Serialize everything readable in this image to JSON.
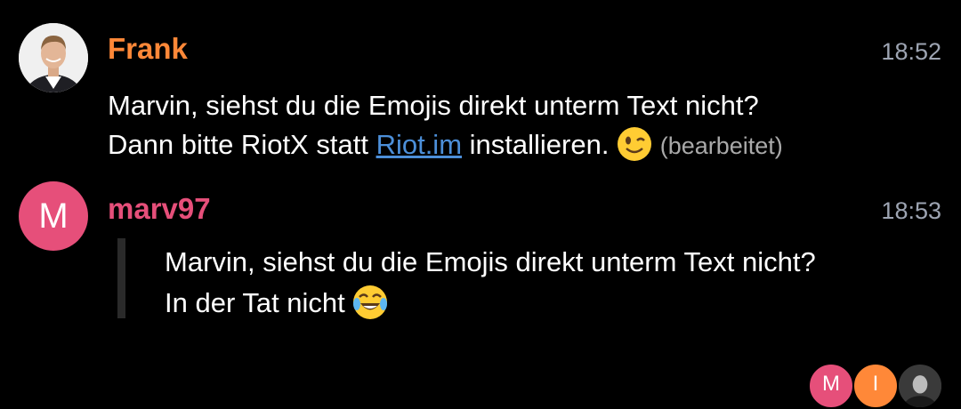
{
  "messages": [
    {
      "sender": "Frank",
      "sender_color": "#ff8838",
      "time": "18:52",
      "avatar": "frank-photo",
      "lines": {
        "line1": "Marvin, siehst du die Emojis direkt unterm Text nicht?",
        "line2_prefix": "Dann bitte RiotX statt",
        "link_text": "Riot.im",
        "line2_suffix": "installieren.",
        "emoji": "winking-face",
        "edited": "(bearbeitet)"
      }
    },
    {
      "sender": "marv97",
      "sender_color": "#e64f7a",
      "time": "18:53",
      "avatar_letter": "M",
      "avatar_color": "#e64f7a",
      "lines": {
        "quote_line1": "Marvin, siehst du die Emojis direkt unterm Text nicht?",
        "quote_line2": "In der Tat nicht",
        "emoji": "face-with-tears-of-joy"
      }
    }
  ],
  "read_receipts": [
    {
      "letter": "M",
      "color": "#e64f7a"
    },
    {
      "letter": "I",
      "color": "#ff8838"
    },
    {
      "avatar": "photo-avatar"
    }
  ]
}
